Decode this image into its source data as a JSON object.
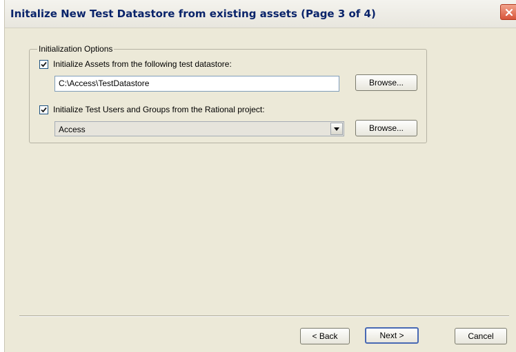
{
  "window": {
    "title": "Initalize New Test Datastore from existing assets (Page 3 of 4)",
    "close_icon": "close-x-icon"
  },
  "group": {
    "legend": "Initialization Options",
    "assets": {
      "checked": true,
      "label": "Initialize Assets from the following test datastore:",
      "path_value": "C:\\Access\\TestDatastore",
      "browse_label": "Browse..."
    },
    "users": {
      "checked": true,
      "label": "Initialize Test Users and Groups from the Rational project:",
      "project_value": "Access",
      "browse_label": "Browse..."
    }
  },
  "footer": {
    "back_label": "< Back",
    "next_label": "Next >",
    "cancel_label": "Cancel"
  },
  "colors": {
    "dialog_bg": "#ece9d8",
    "title_text": "#0a246a",
    "close_button": "#d8553a",
    "default_button_border": "#4768b3"
  }
}
